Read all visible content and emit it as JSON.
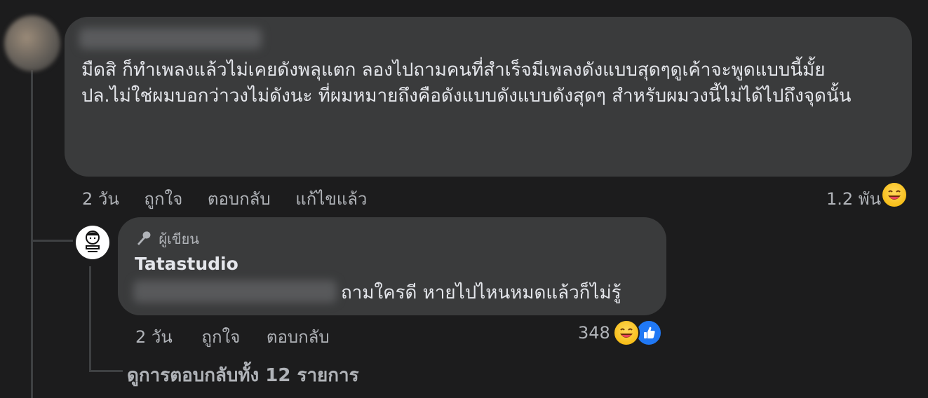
{
  "comment": {
    "text_line1": "มืดสิ ก็ทำเพลงแล้วไม่เคยดังพลุแตก ลองไปถามคนที่สำเร็จมีเพลงดังแบบสุดๆดูเค้าจะพูดแบบนี้มั้ย",
    "text_line2": "ปล.ไม่ใช่ผมบอกว่าวงไม่ดังนะ ที่ผมหมายถึงคือดังแบบดังแบบดังสุดๆ สำหรับผมวงนี้ไม่ได้ไปถึงจุดนั้น",
    "time": "2 วัน",
    "like_label": "ถูกใจ",
    "reply_label": "ตอบกลับ",
    "edited_label": "แก้ไขแล้ว",
    "reaction_count": "1.2 พัน",
    "reaction_icon": "laugh-emoji"
  },
  "reply": {
    "badge_label": "ผู้เขียน",
    "badge_icon": "microphone-icon",
    "author": "Tatastudio",
    "text": "ถามใครดี หายไปไหนหมดแล้วก็ไม่รู้",
    "time": "2 วัน",
    "like_label": "ถูกใจ",
    "reply_label": "ตอบกลับ",
    "reaction_count": "348",
    "reaction_icons": [
      "laugh-emoji",
      "like-emoji"
    ]
  },
  "view_replies_label": "ดูการตอบกลับทั้ง 12 รายการ",
  "colors": {
    "background": "#1c1c1d",
    "bubble": "#3a3b3c",
    "text": "#e4e6eb",
    "secondary_text": "#b0b3b8",
    "like_blue": "#2078f4"
  }
}
